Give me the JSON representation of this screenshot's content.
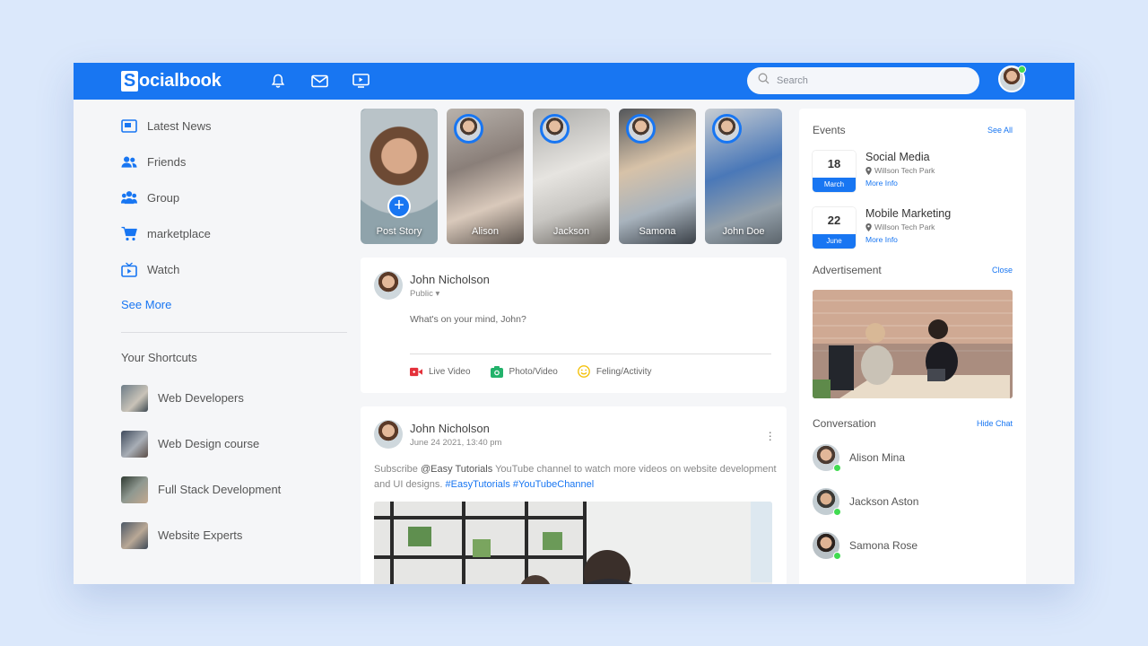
{
  "app": {
    "logo_letter": "S",
    "logo_rest": "ocialbook"
  },
  "navbar": {
    "icons": [
      "bell-icon",
      "mail-icon",
      "video-icon"
    ],
    "search_placeholder": "Search"
  },
  "sidebar": {
    "items": [
      {
        "label": "Latest News",
        "icon": "news-icon"
      },
      {
        "label": "Friends",
        "icon": "friends-icon"
      },
      {
        "label": "Group",
        "icon": "group-icon"
      },
      {
        "label": "marketplace",
        "icon": "cart-icon"
      },
      {
        "label": "Watch",
        "icon": "tv-icon"
      }
    ],
    "see_more": "See More",
    "shortcuts_title": "Your Shortcuts",
    "shortcuts": [
      {
        "label": "Web Developers"
      },
      {
        "label": "Web Design course"
      },
      {
        "label": "Full Stack Development"
      },
      {
        "label": "Website Experts"
      }
    ]
  },
  "stories": [
    {
      "name": "Post Story"
    },
    {
      "name": "Alison"
    },
    {
      "name": "Jackson"
    },
    {
      "name": "Samona"
    },
    {
      "name": "John Doe"
    }
  ],
  "composer": {
    "user_name": "John Nicholson",
    "privacy": "Public",
    "placeholder": "What's on your mind, John?",
    "actions": [
      {
        "label": "Live Video",
        "icon": "live-video-icon",
        "color": "#e4313b"
      },
      {
        "label": "Photo/Video",
        "icon": "photo-icon",
        "color": "#23b26b"
      },
      {
        "label": "Feling/Activity",
        "icon": "smile-icon",
        "color": "#f4c20d"
      }
    ]
  },
  "post": {
    "user_name": "John Nicholson",
    "timestamp": "June 24 2021, 13:40 pm",
    "text_before": "Subscribe ",
    "mention": "@Easy Tutorials",
    "text_after": " YouTube channel to watch more videos on website development and UI designs. ",
    "tags": "#EasyTutorials #YouTubeChannel"
  },
  "events": {
    "title": "Events",
    "link": "See All",
    "items": [
      {
        "day": "18",
        "month": "March",
        "title": "Social Media",
        "place": "Willson Tech Park",
        "more": "More Info"
      },
      {
        "day": "22",
        "month": "June",
        "title": "Mobile Marketing",
        "place": "Willson Tech Park",
        "more": "More Info"
      }
    ]
  },
  "advertisement": {
    "title": "Advertisement",
    "link": "Close"
  },
  "conversation": {
    "title": "Conversation",
    "link": "Hide Chat",
    "contacts": [
      {
        "name": "Alison Mina"
      },
      {
        "name": "Jackson Aston"
      },
      {
        "name": "Samona Rose"
      }
    ]
  },
  "colors": {
    "brand": "#1876f2",
    "online": "#41db51",
    "background": "#f5f6f8"
  }
}
